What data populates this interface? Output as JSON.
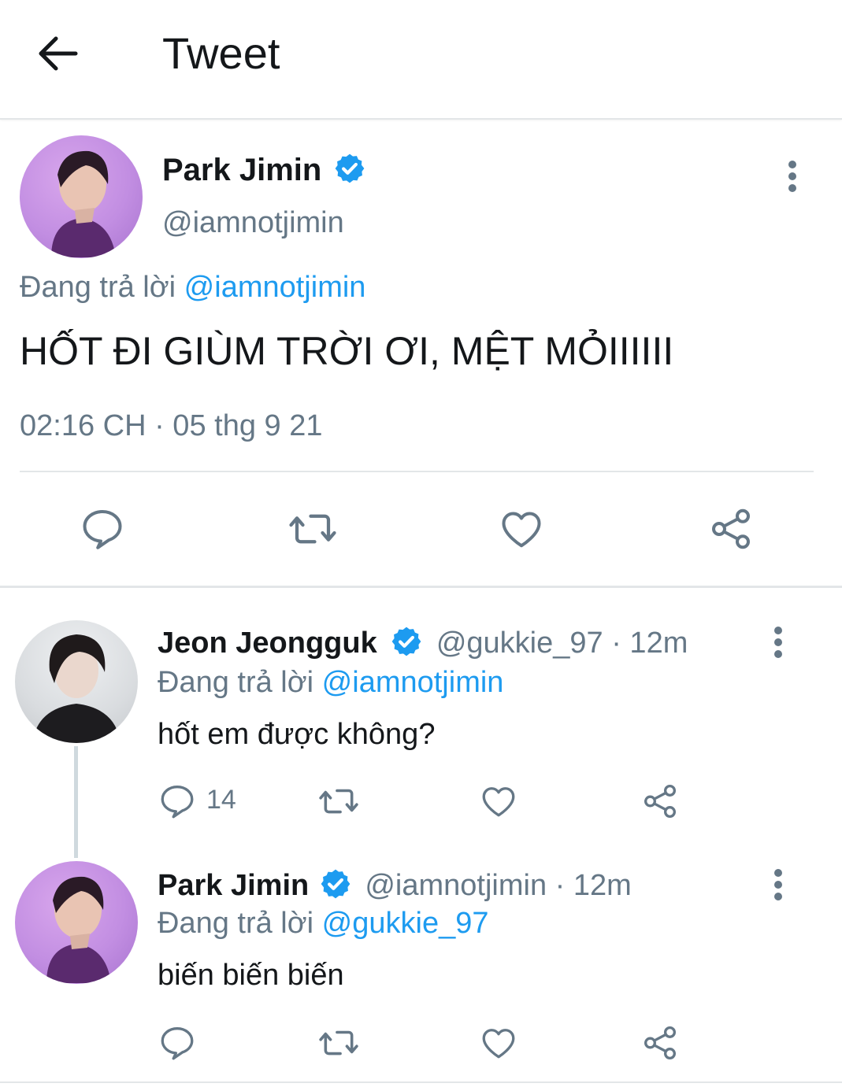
{
  "header": {
    "title": "Tweet"
  },
  "main_tweet": {
    "author_name": "Park Jimin",
    "handle": "@iamnotjimin",
    "replying_prefix": "Đang trả lời",
    "replying_to": "@iamnotjimin",
    "text": "HỐT ĐI GIÙM TRỜI ƠI, MỆT MỎIIIIII",
    "timestamp": "02:16 CH · 05 thg 9 21"
  },
  "replies": [
    {
      "author_name": "Jeon Jeongguk",
      "meta": "@gukkie_97 · 12m",
      "replying_prefix": "Đang trả lời",
      "replying_to": "@iamnotjimin",
      "text": "hốt em được không?",
      "reply_count": "14"
    },
    {
      "author_name": "Park Jimin",
      "meta": "@iamnotjimin · 12m",
      "replying_prefix": "Đang trả lời",
      "replying_to": "@gukkie_97",
      "text": "biến biến biến"
    }
  ],
  "icons": [
    "back-arrow-icon",
    "verified-badge-icon",
    "more-vertical-icon",
    "reply-icon",
    "retweet-icon",
    "like-icon",
    "share-icon"
  ],
  "colors": {
    "accent": "#1d9bf0",
    "muted": "#657786",
    "text": "#14171a",
    "divider": "#e3e6e8"
  }
}
